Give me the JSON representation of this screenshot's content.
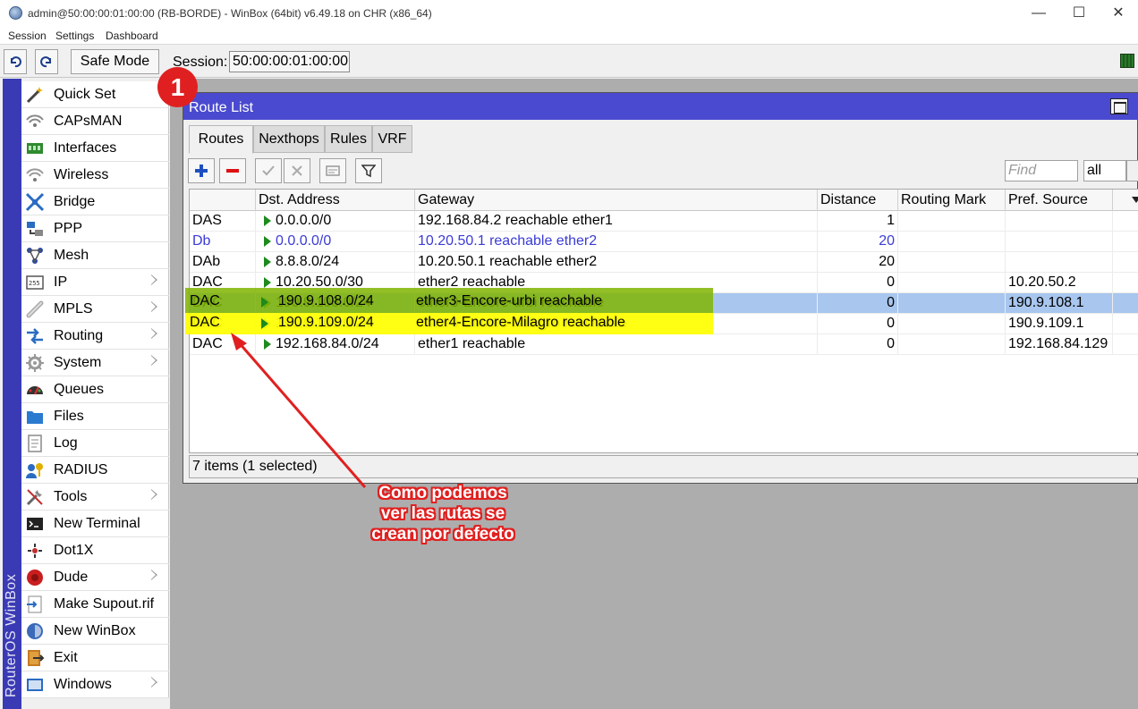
{
  "window": {
    "title": "admin@50:00:00:01:00:00 (RB-BORDE) - WinBox (64bit) v6.49.18 on CHR (x86_64)",
    "controls": [
      "—",
      "☐",
      "✕"
    ]
  },
  "menu": [
    "Session",
    "Settings",
    "Dashboard"
  ],
  "toolbar": {
    "safe_mode": "Safe Mode",
    "session_label": "Session:",
    "session_value": "50:00:00:01:00:00"
  },
  "brand": "RouterOS WinBox",
  "sidebar": [
    {
      "label": "Quick Set",
      "icon": "wand-icon",
      "submenu": false
    },
    {
      "label": "CAPsMAN",
      "icon": "antenna-icon",
      "submenu": false
    },
    {
      "label": "Interfaces",
      "icon": "interfaces-icon",
      "submenu": false
    },
    {
      "label": "Wireless",
      "icon": "wireless-icon",
      "submenu": false
    },
    {
      "label": "Bridge",
      "icon": "bridge-icon",
      "submenu": false
    },
    {
      "label": "PPP",
      "icon": "ppp-icon",
      "submenu": false
    },
    {
      "label": "Mesh",
      "icon": "mesh-icon",
      "submenu": false
    },
    {
      "label": "IP",
      "icon": "ip-icon",
      "submenu": true
    },
    {
      "label": "MPLS",
      "icon": "mpls-icon",
      "submenu": true
    },
    {
      "label": "Routing",
      "icon": "routing-icon",
      "submenu": true
    },
    {
      "label": "System",
      "icon": "gear-icon",
      "submenu": true
    },
    {
      "label": "Queues",
      "icon": "queues-icon",
      "submenu": false
    },
    {
      "label": "Files",
      "icon": "folder-icon",
      "submenu": false
    },
    {
      "label": "Log",
      "icon": "log-icon",
      "submenu": false
    },
    {
      "label": "RADIUS",
      "icon": "radius-icon",
      "submenu": false
    },
    {
      "label": "Tools",
      "icon": "tools-icon",
      "submenu": true
    },
    {
      "label": "New Terminal",
      "icon": "terminal-icon",
      "submenu": false
    },
    {
      "label": "Dot1X",
      "icon": "dot1x-icon",
      "submenu": false
    },
    {
      "label": "Dude",
      "icon": "dude-icon",
      "submenu": true
    },
    {
      "label": "Make Supout.rif",
      "icon": "supout-icon",
      "submenu": false
    },
    {
      "label": "New WinBox",
      "icon": "winbox-icon",
      "submenu": false
    },
    {
      "label": "Exit",
      "icon": "exit-icon",
      "submenu": false
    },
    {
      "label": "Windows",
      "icon": "windows-icon",
      "submenu": true
    }
  ],
  "badge": "1",
  "route_window": {
    "title": "Route List",
    "tabs": [
      "Routes",
      "Nexthops",
      "Rules",
      "VRF"
    ],
    "active_tab": "Routes",
    "find_placeholder": "Find",
    "filter_value": "all",
    "columns": [
      "",
      "Dst. Address",
      "Gateway",
      "Distance",
      "Routing Mark",
      "Pref. Source"
    ],
    "rows": [
      {
        "flags": "DAS",
        "dst": "0.0.0.0/0",
        "gateway": "192.168.84.2 reachable ether1",
        "distance": "1",
        "routing_mark": "",
        "pref_source": "",
        "state": "normal"
      },
      {
        "flags": "Db",
        "dst": "0.0.0.0/0",
        "gateway": "10.20.50.1 reachable ether2",
        "distance": "20",
        "routing_mark": "",
        "pref_source": "",
        "state": "dynamic"
      },
      {
        "flags": "DAb",
        "dst": "8.8.8.0/24",
        "gateway": "10.20.50.1 reachable ether2",
        "distance": "20",
        "routing_mark": "",
        "pref_source": "",
        "state": "normal"
      },
      {
        "flags": "DAC",
        "dst": "10.20.50.0/30",
        "gateway": "ether2 reachable",
        "distance": "0",
        "routing_mark": "",
        "pref_source": "10.20.50.2",
        "state": "normal"
      },
      {
        "flags": "DAC",
        "dst": "190.9.108.0/24",
        "gateway": "ether3-Encore-urbi reachable",
        "distance": "0",
        "routing_mark": "",
        "pref_source": "190.9.108.1",
        "state": "selected"
      },
      {
        "flags": "DAC",
        "dst": "190.9.109.0/24",
        "gateway": "ether4-Encore-Milagro reachable",
        "distance": "0",
        "routing_mark": "",
        "pref_source": "190.9.109.1",
        "state": "highlight"
      },
      {
        "flags": "DAC",
        "dst": "192.168.84.0/24",
        "gateway": "ether1 reachable",
        "distance": "0",
        "routing_mark": "",
        "pref_source": "192.168.84.129",
        "state": "normal"
      }
    ],
    "status": "7 items (1 selected)"
  },
  "annotation": {
    "lines": [
      "Como podemos",
      "ver las rutas se",
      "crean por defecto"
    ],
    "color": "#e02020"
  },
  "colors": {
    "title_bar": "#4a4ad0",
    "brand_strip": "#3a3ab5",
    "selected_row": "#a8c6ee",
    "highlight_green": "#80b400",
    "highlight_yellow": "#ffff00",
    "dynamic_text": "#3b3bd6"
  }
}
